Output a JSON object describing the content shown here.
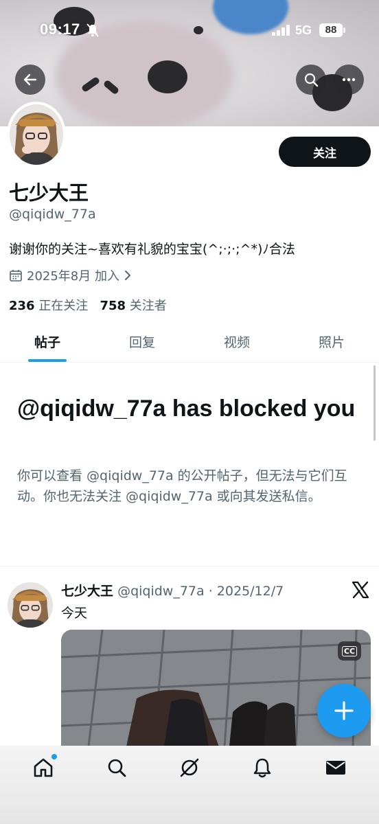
{
  "status_bar": {
    "time": "09:17",
    "network": "5G",
    "battery": "88"
  },
  "profile": {
    "follow_label": "关注",
    "name": "七少大王",
    "handle": "@qiqidw_77a",
    "bio": "谢谢你的关注~喜欢有礼貌的宝宝(^;·;·;^*)ﾉ合法",
    "joined": "2025年8月 加入",
    "following_count": "236",
    "following_label": "正在关注",
    "followers_count": "758",
    "followers_label": "关注者"
  },
  "tabs": [
    {
      "label": "帖子",
      "active": true
    },
    {
      "label": "回复",
      "active": false
    },
    {
      "label": "视频",
      "active": false
    },
    {
      "label": "照片",
      "active": false
    }
  ],
  "blocked": {
    "title": "@qiqidw_77a has blocked you",
    "text": "你可以查看 @qiqidw_77a 的公开帖子，但无法与它们互动。你也无法关注 @qiqidw_77a 或向其发送私信。"
  },
  "post": {
    "name": "七少大王",
    "handle_date": "@qiqidw_77a · 2025/12/7",
    "text": "今天",
    "cc_label": "CC"
  },
  "icons": {
    "back": "back-arrow-icon",
    "search": "search-icon",
    "more": "more-icon",
    "calendar": "calendar-icon",
    "chevron": "chevron-right-icon",
    "home": "home-icon",
    "explore": "search-icon",
    "grok": "grok-icon",
    "notifications": "bell-icon",
    "messages": "mail-icon",
    "compose": "plus-icon"
  },
  "colors": {
    "accent": "#1d9bf0",
    "text": "#0f1419",
    "secondary": "#536471"
  }
}
